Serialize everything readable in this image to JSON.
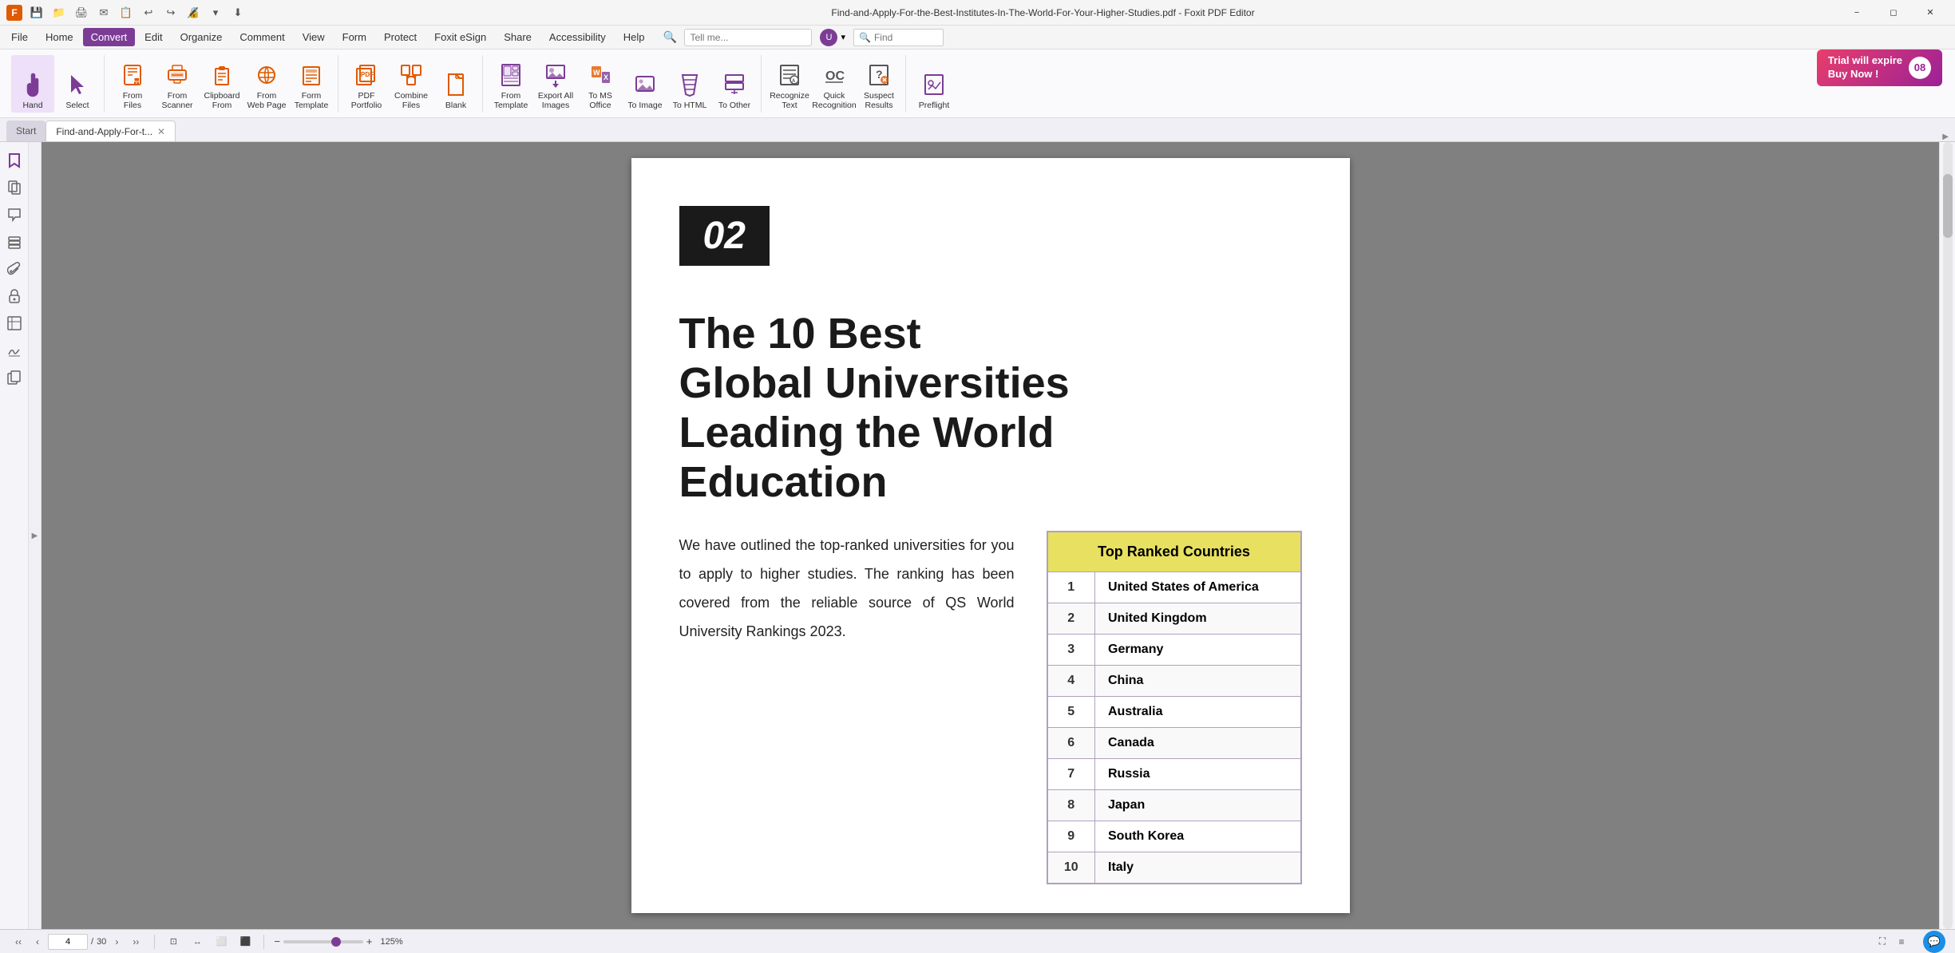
{
  "titlebar": {
    "title": "Find-and-Apply-For-the-Best-Institutes-In-The-World-For-Your-Higher-Studies.pdf - Foxit PDF Editor",
    "window_controls": [
      "minimize",
      "maximize",
      "close"
    ]
  },
  "menubar": {
    "items": [
      "File",
      "Home",
      "Convert",
      "Edit",
      "Organize",
      "Comment",
      "View",
      "Form",
      "Protect",
      "Foxit eSign",
      "Share",
      "Accessibility",
      "Help"
    ],
    "active_item": "Convert",
    "search_placeholder": "Tell me...",
    "find_label": "Find"
  },
  "ribbon": {
    "groups": [
      {
        "name": "tools",
        "buttons": [
          {
            "id": "hand",
            "label": "Hand",
            "icon": "hand"
          },
          {
            "id": "select",
            "label": "Select",
            "icon": "cursor"
          }
        ]
      },
      {
        "name": "from",
        "buttons": [
          {
            "id": "from-files",
            "label": "From Files",
            "icon": "file"
          },
          {
            "id": "from-scanner",
            "label": "From Scanner",
            "icon": "scanner"
          },
          {
            "id": "from-clipboard",
            "label": "From Clipboard",
            "icon": "clipboard"
          },
          {
            "id": "from-web-page",
            "label": "From Web Page",
            "icon": "globe"
          },
          {
            "id": "form",
            "label": "Form Template",
            "icon": "form"
          }
        ]
      },
      {
        "name": "create",
        "buttons": [
          {
            "id": "pdf-portfolio",
            "label": "PDF Portfolio",
            "icon": "portfolio"
          },
          {
            "id": "combine",
            "label": "Combine Files",
            "icon": "combine"
          },
          {
            "id": "blank",
            "label": "Blank",
            "icon": "blank"
          }
        ]
      },
      {
        "name": "convert2",
        "buttons": [
          {
            "id": "from-template",
            "label": "From Template",
            "icon": "template"
          },
          {
            "id": "export-all",
            "label": "Export All Images",
            "icon": "export-img"
          },
          {
            "id": "to-ms-office",
            "label": "To MS Office",
            "icon": "office"
          },
          {
            "id": "to-image",
            "label": "To Image",
            "icon": "image"
          },
          {
            "id": "to-html",
            "label": "To HTML",
            "icon": "html"
          },
          {
            "id": "to-other",
            "label": "To Other",
            "icon": "other"
          }
        ]
      },
      {
        "name": "ocr",
        "buttons": [
          {
            "id": "recognize",
            "label": "Recognize Text",
            "icon": "ocr"
          },
          {
            "id": "quick-recognition",
            "label": "Quick Recognition",
            "icon": "quick"
          },
          {
            "id": "suspect",
            "label": "Suspect Results",
            "icon": "suspect"
          }
        ]
      },
      {
        "name": "preflight",
        "buttons": [
          {
            "id": "preflight",
            "label": "Preflight",
            "icon": "preflight"
          }
        ]
      }
    ]
  },
  "trial": {
    "line1": "Trial will expire",
    "line2": "Buy Now !",
    "badge": "08"
  },
  "tabs": {
    "items": [
      {
        "id": "start",
        "label": "Start",
        "closeable": false,
        "active": false
      },
      {
        "id": "doc",
        "label": "Find-and-Apply-For-t...",
        "closeable": true,
        "active": true
      }
    ]
  },
  "sidebar": {
    "icons": [
      {
        "id": "bookmark",
        "symbol": "🔖"
      },
      {
        "id": "pages",
        "symbol": "📄"
      },
      {
        "id": "comments",
        "symbol": "💬"
      },
      {
        "id": "layers",
        "symbol": "📚"
      },
      {
        "id": "attach",
        "symbol": "📎"
      },
      {
        "id": "lock",
        "symbol": "🔒"
      },
      {
        "id": "pages2",
        "symbol": "📋"
      },
      {
        "id": "sign",
        "symbol": "✍"
      },
      {
        "id": "copy",
        "symbol": "⧉"
      }
    ]
  },
  "pdf": {
    "page_number": "02",
    "title_line1": "The 10 Best",
    "title_line2": "Global Universities",
    "title_line3": "Leading the World",
    "title_line4": "Education",
    "description": "We have outlined the top-ranked universities for you to apply to higher studies. The ranking has been covered from the reliable source of QS World University Rankings 2023.",
    "table": {
      "header": "Top Ranked Countries",
      "rows": [
        {
          "rank": "1",
          "country": "United States of America"
        },
        {
          "rank": "2",
          "country": "United Kingdom"
        },
        {
          "rank": "3",
          "country": "Germany"
        },
        {
          "rank": "4",
          "country": "China"
        },
        {
          "rank": "5",
          "country": "Australia"
        },
        {
          "rank": "6",
          "country": "Canada"
        },
        {
          "rank": "7",
          "country": "Russia"
        },
        {
          "rank": "8",
          "country": "Japan"
        },
        {
          "rank": "9",
          "country": "South Korea"
        },
        {
          "rank": "10",
          "country": "Italy"
        }
      ]
    }
  },
  "bottombar": {
    "current_page": "4",
    "total_pages": "30",
    "zoom": "125%"
  }
}
